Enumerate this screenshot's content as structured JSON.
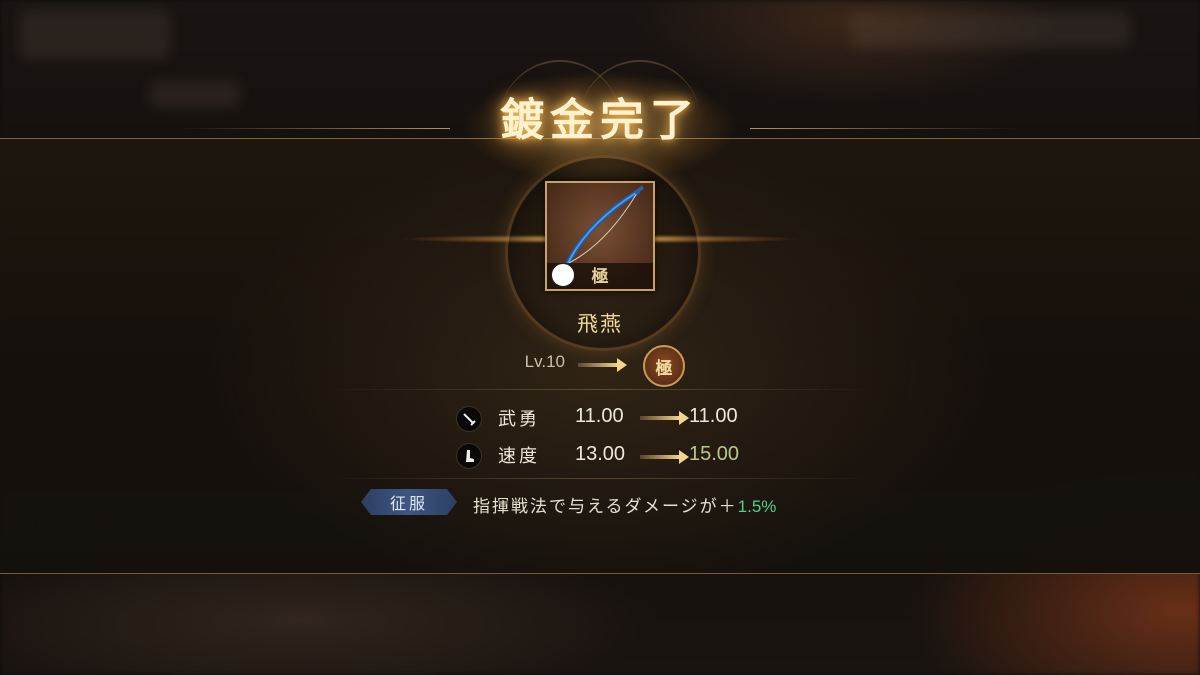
{
  "result": {
    "title": "鍍金完了"
  },
  "item": {
    "name": "飛燕",
    "grade_label": "極",
    "icon": "bow-icon",
    "level_before": "Lv.10",
    "level_after_badge": "極"
  },
  "stats": [
    {
      "icon": "sword-icon",
      "label": "武勇",
      "before": "11.00",
      "after": "11.00",
      "increased": false
    },
    {
      "icon": "boot-icon",
      "label": "速度",
      "before": "13.00",
      "after": "15.00",
      "increased": true
    }
  ],
  "conquest": {
    "tag": "征服",
    "effect_text": "指揮戦法で与えるダメージが＋",
    "effect_value": "1.5%",
    "effect_value_color": "#4fd08a"
  },
  "colors": {
    "title_glow": "#ffc864",
    "frame_gold": "#c9a25c",
    "stat_increase": "#b8c98a"
  }
}
